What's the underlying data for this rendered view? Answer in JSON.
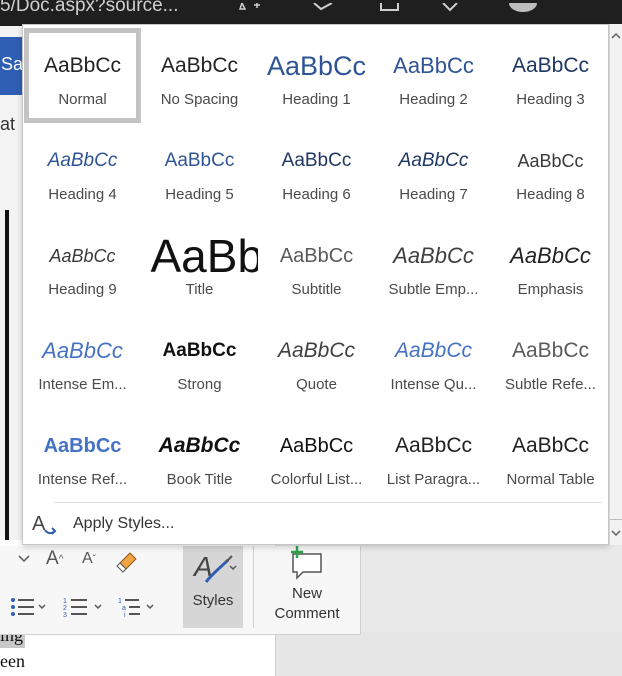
{
  "titlebar": {
    "url_fragment": "5/Doc.aspx?source..."
  },
  "left": {
    "save_label": "Sa",
    "partial_text": "at"
  },
  "document": {
    "line1": "ing",
    "line2": "een"
  },
  "gallery": {
    "styles": [
      {
        "sample": "AaBbCc",
        "name": "Normal",
        "cls": "s-normal",
        "selected": true
      },
      {
        "sample": "AaBbCc",
        "name": "No Spacing",
        "cls": "s-nospace"
      },
      {
        "sample": "AaBbCc",
        "name": "Heading 1",
        "cls": "s-h1"
      },
      {
        "sample": "AaBbCc",
        "name": "Heading 2",
        "cls": "s-h2"
      },
      {
        "sample": "AaBbCc",
        "name": "Heading 3",
        "cls": "s-h3"
      },
      {
        "sample": "AaBbCc",
        "name": "Heading 4",
        "cls": "s-h4"
      },
      {
        "sample": "AaBbCc",
        "name": "Heading 5",
        "cls": "s-h5"
      },
      {
        "sample": "AaBbCc",
        "name": "Heading 6",
        "cls": "s-h6"
      },
      {
        "sample": "AaBbCc",
        "name": "Heading 7",
        "cls": "s-h7"
      },
      {
        "sample": "AaBbCc",
        "name": "Heading 8",
        "cls": "s-h8"
      },
      {
        "sample": "AaBbCc",
        "name": "Heading 9",
        "cls": "s-h9"
      },
      {
        "sample": "AaBb",
        "name": "Title",
        "cls": "s-title"
      },
      {
        "sample": "AaBbCc",
        "name": "Subtitle",
        "cls": "s-subtitle"
      },
      {
        "sample": "AaBbCc",
        "name": "Subtle Emp...",
        "cls": "s-subtleemp"
      },
      {
        "sample": "AaBbCc",
        "name": "Emphasis",
        "cls": "s-emphasis"
      },
      {
        "sample": "AaBbCc",
        "name": "Intense Em...",
        "cls": "s-intenseemp"
      },
      {
        "sample": "AaBbCc",
        "name": "Strong",
        "cls": "s-strong"
      },
      {
        "sample": "AaBbCc",
        "name": "Quote",
        "cls": "s-quote"
      },
      {
        "sample": "AaBbCc",
        "name": "Intense Qu...",
        "cls": "s-intensequote"
      },
      {
        "sample": "AaBbCc",
        "name": "Subtle Refe...",
        "cls": "s-subtleref"
      },
      {
        "sample": "AaBbCc",
        "name": "Intense Ref...",
        "cls": "s-intenseref"
      },
      {
        "sample": "AaBbCc",
        "name": "Book Title",
        "cls": "s-booktitle"
      },
      {
        "sample": "AaBbCc",
        "name": "Colorful List...",
        "cls": "s-colorful"
      },
      {
        "sample": "AaBbCc",
        "name": "List Paragra...",
        "cls": "s-listpara"
      },
      {
        "sample": "AaBbCc",
        "name": "Normal Table",
        "cls": "s-normaltable"
      }
    ],
    "apply_styles_label": "Apply Styles..."
  },
  "ribbon": {
    "grow_font_glyph": "A",
    "shrink_font_glyph": "A",
    "styles_label": "Styles",
    "new_comment_label_1": "New",
    "new_comment_label_2": "Comment"
  },
  "colors": {
    "heading_blue": "#2f5496",
    "accent_blue": "#4472c4",
    "styles_active_bg": "#d6d6d6",
    "comment_plus": "#2da44e"
  }
}
